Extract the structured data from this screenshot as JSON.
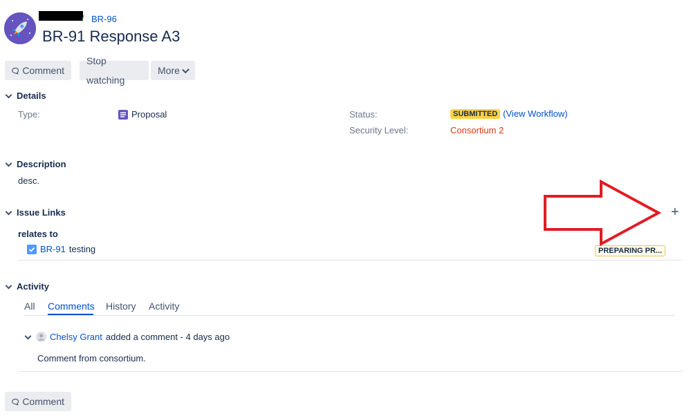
{
  "header": {
    "parent_key": "BR-96",
    "separator": "/",
    "title": "BR-91 Response A3"
  },
  "toolbar": {
    "comment_label": "Comment",
    "stop_watching_label": "Stop watching",
    "more_label": "More"
  },
  "details": {
    "heading": "Details",
    "type_label": "Type:",
    "type_value": "Proposal",
    "status_label": "Status:",
    "status_value": "SUBMITTED",
    "view_workflow": "(View Workflow)",
    "security_label": "Security Level:",
    "security_value": "Consortium 2"
  },
  "description": {
    "heading": "Description",
    "text": "desc."
  },
  "issue_links": {
    "heading": "Issue Links",
    "add_glyph": "+",
    "relation": "relates to",
    "link_key": "BR-91",
    "link_summary": "testing",
    "link_status": "PREPARING PR..."
  },
  "activity": {
    "heading": "Activity",
    "tabs": [
      "All",
      "Comments",
      "History",
      "Activity"
    ],
    "active_tab": "Comments",
    "comment": {
      "author": "Chelsy Grant",
      "action": "added a comment - 4 days ago",
      "body": "Comment from consortium."
    }
  },
  "footer": {
    "comment_label": "Comment"
  },
  "colors": {
    "link": "#0052cc",
    "security_red": "#de350b",
    "status_yellow": "#ffd240",
    "annotation_arrow": "#e31b23",
    "type_icon": "#6554c0"
  },
  "icons": [
    "rocket-avatar-icon",
    "comment-bubble-icon",
    "chevron-down-icon",
    "proposal-type-icon",
    "checkbox-checked-icon",
    "user-avatar-icon",
    "plus-icon",
    "red-arrow-annotation"
  ]
}
